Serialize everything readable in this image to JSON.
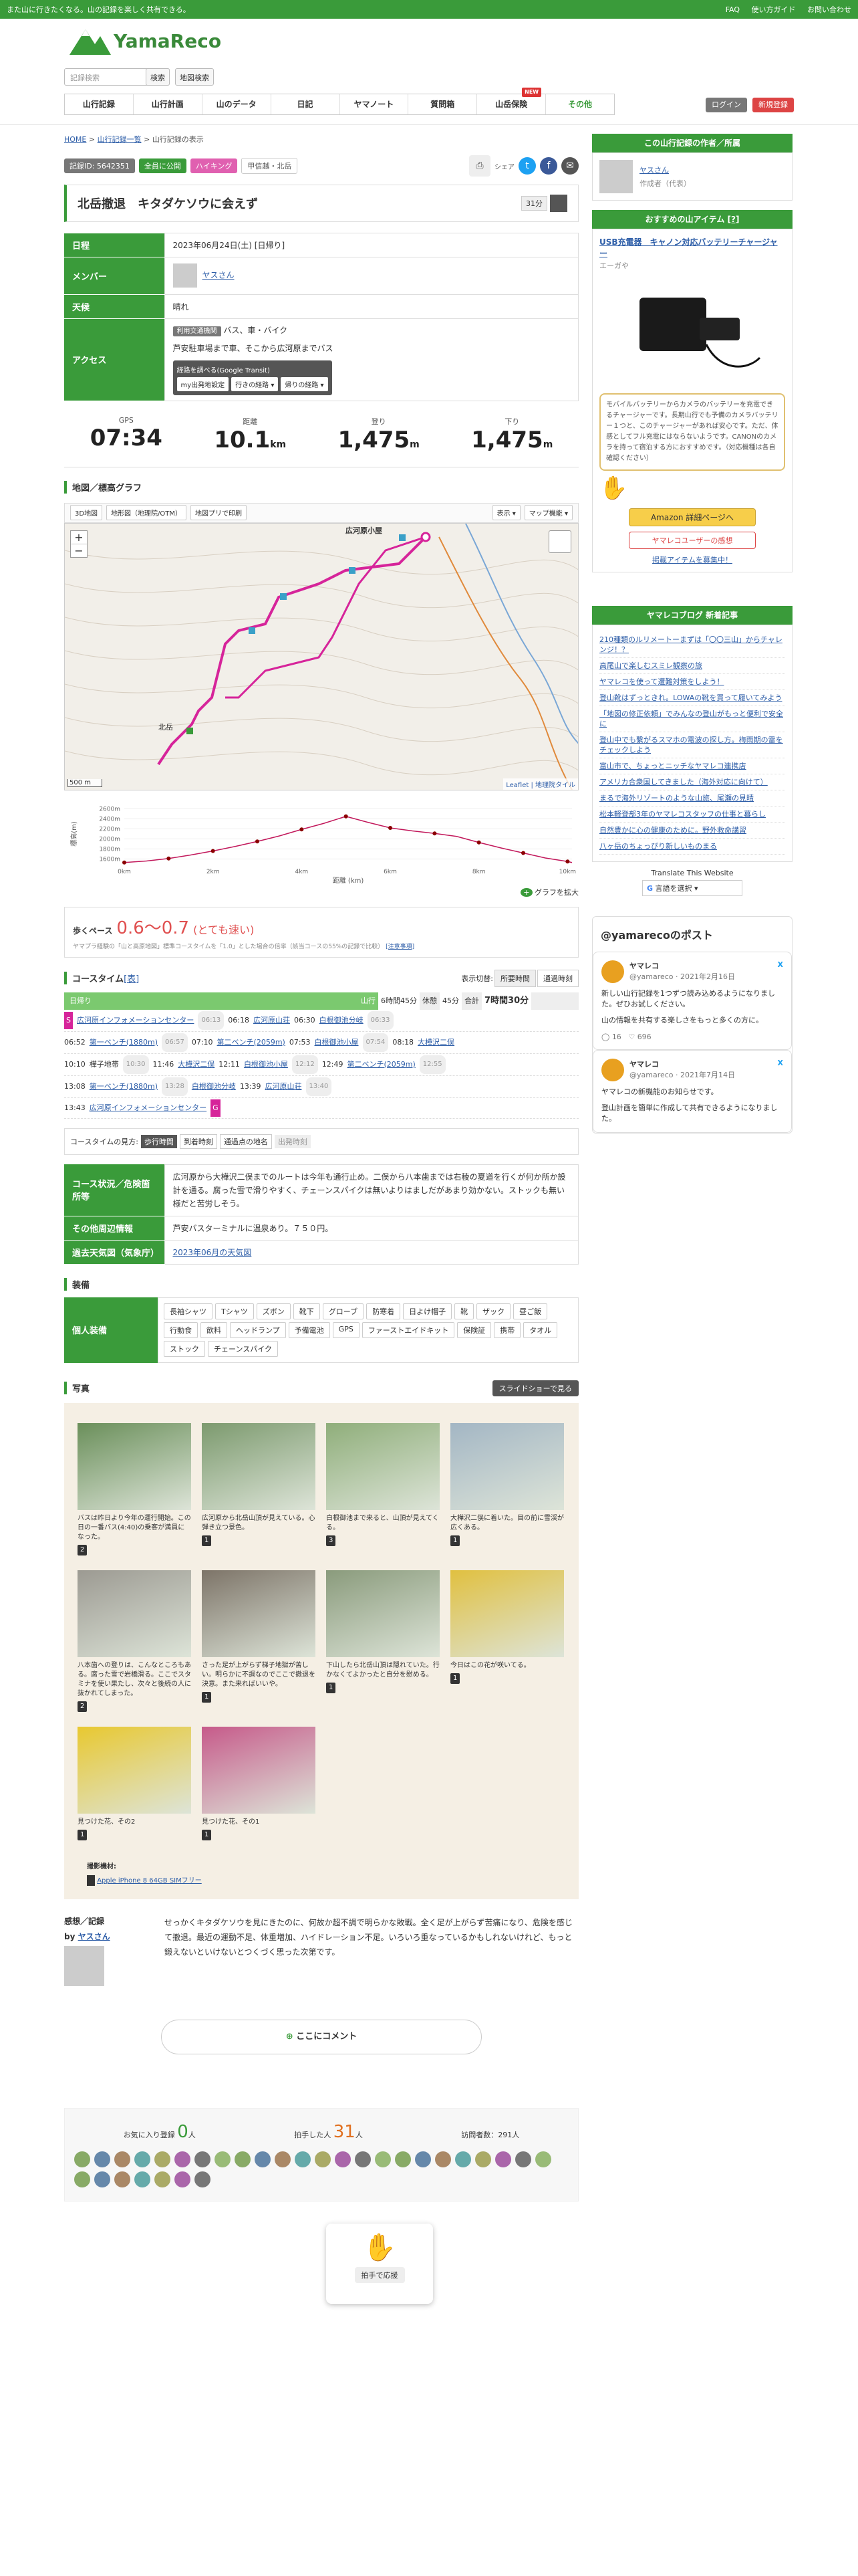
{
  "topbar": {
    "tagline": "また山に行きたくなる。山の記録を楽しく共有できる。",
    "links": [
      "FAQ",
      "使い方ガイド",
      "お問い合わせ"
    ]
  },
  "header": {
    "logo_text": "YamaReco",
    "search_placeholder": "記録検索",
    "search_button": "検索",
    "map_search_button": "地図検索",
    "nav": [
      "山行記録",
      "山行計画",
      "山のデータ",
      "日記",
      "ヤマノート",
      "質問箱",
      "山岳保険",
      "その他"
    ],
    "new_badge": "NEW",
    "login": "ログイン",
    "register": "新規登録"
  },
  "breadcrumb": {
    "home": "HOME",
    "list": "山行記録一覧",
    "current": "山行記録の表示"
  },
  "record": {
    "id": "記録ID: 5642351",
    "visibility": "全員に公開",
    "category": "ハイキング",
    "area": "甲信越・北岳",
    "share_label": "シェア",
    "title": "北岳撤退　キタダケソウに会えず",
    "count": "31",
    "count_unit": "分",
    "date_label": "日程",
    "date_value": "2023年06月24日(土) [日帰り]",
    "member_label": "メンバー",
    "member_name": "ヤスさん",
    "weather_label": "天候",
    "weather_value": "晴れ",
    "access_label": "アクセス",
    "access_tag": "利用交通機関",
    "access_mode": "バス、車・バイク",
    "access_note": "芦安駐車場まで車、そこから広河原までバス",
    "transit_label": "経路を調べる(Google Transit)",
    "transit_buttons": [
      "my出発地設定",
      "行きの経路 ▾",
      "帰りの経路 ▾"
    ]
  },
  "stats": [
    {
      "label": "GPS",
      "value": "07:34",
      "unit": ""
    },
    {
      "label": "距離",
      "value": "10.1",
      "unit": "km"
    },
    {
      "label": "登り",
      "value": "1,475",
      "unit": "m"
    },
    {
      "label": "下り",
      "value": "1,475",
      "unit": "m"
    }
  ],
  "map_section": {
    "title": "地図／標高グラフ",
    "buttons": [
      "3D地図",
      "地形図（地理院/OTM）",
      "地図プリで印刷"
    ],
    "right_buttons": [
      "表示 ▾",
      "マップ機能 ▾"
    ],
    "place_label": "広河原小屋",
    "place_label2": "北岳",
    "scale": "500 m",
    "attribution": "Leaflet | 地理院タイル",
    "zoom_in": "+",
    "zoom_out": "−"
  },
  "elevation": {
    "ylabel": "標高(m)",
    "xlabel": "距離 (km)",
    "enlarge": "グラフを拡大"
  },
  "chart_data": {
    "type": "line",
    "xlabel": "距離 (km)",
    "ylabel": "標高(m)",
    "x": [
      0,
      0.5,
      1,
      1.5,
      2,
      2.5,
      3,
      3.5,
      4,
      4.5,
      5,
      5.5,
      6,
      6.5,
      7,
      7.5,
      8,
      8.5,
      9,
      9.5,
      10,
      10.1
    ],
    "y": [
      1530,
      1560,
      1610,
      1680,
      1760,
      1850,
      1950,
      2060,
      2190,
      2310,
      2450,
      2330,
      2220,
      2160,
      2110,
      2050,
      1930,
      1820,
      1720,
      1620,
      1550,
      1530
    ],
    "xticks": [
      "0km",
      "2km",
      "4km",
      "6km",
      "8km",
      "10km"
    ],
    "yticks": [
      "1600m",
      "1800m",
      "2000m",
      "2200m",
      "2400m",
      "2600m"
    ],
    "ylim": [
      1500,
      2700
    ],
    "xlim": [
      0,
      10.1
    ]
  },
  "pace": {
    "label": "歩くペース",
    "value": "0.6〜0.7",
    "note": "(とても速い)",
    "sub": "ヤマプラ経験の「山と高原地図」標準コースタイムを「1.0」とした場合の倍率（該当コースの55%の記録で比較）",
    "link": "[注意事項]"
  },
  "coursetime": {
    "title": "コースタイム",
    "title_link": "[表]",
    "toggle_label": "表示切替:",
    "toggle_opts": [
      "所要時間",
      "通過時刻"
    ],
    "day_label": "日帰り",
    "mountain": "山行",
    "mountain_time": "6時間45分",
    "rest": "休憩",
    "rest_time": "45分",
    "total": "合計",
    "total_time": "7時間30分",
    "rows": [
      [
        "広河原インフォメーションセンター",
        "06:13",
        "06:18",
        "広河原山荘",
        "06:30",
        "白根御池分岐",
        "06:33"
      ],
      [
        "06:52",
        "第一ベンチ(1880m)",
        "06:57",
        "07:10",
        "第二ベンチ(2059m)",
        "07:53",
        "白根御池小屋",
        "07:54",
        "08:18",
        "大樺沢二俣"
      ],
      [
        "10:10",
        "樺子地帯",
        "10:30",
        "11:46",
        "大樺沢二俣",
        "12:11",
        "白根御池小屋",
        "12:12",
        "12:49",
        "第二ベンチ(2059m)",
        "12:55"
      ],
      [
        "13:08",
        "第一ベンチ(1880m)",
        "13:28",
        "白根御池分岐",
        "13:39",
        "広河原山荘",
        "13:40"
      ],
      [
        "13:43",
        "広河原インフォメーションセンター",
        "G"
      ]
    ],
    "view_label": "コースタイムの見方:",
    "view_opts": [
      "歩行時間",
      "到着時刻",
      "通過点の地名",
      "出発時刻"
    ]
  },
  "conditions": {
    "label": "コース状況／危険箇所等",
    "text": "広河原から大樺沢二俣までのルートは今年も通行止め。二俣から八本歯までは右稜の夏道を行くが何か所か設計を通る。腐った雪で滑りやすく、チェーンスパイクは無いよりはましだがあまり効かない。ストックも無い様だと苦労しそう。",
    "other_label": "その他周辺情報",
    "other_text": "芦安バスターミナルに温泉あり。７５０円。",
    "weather_label": "過去天気図（気象庁）",
    "weather_link": "2023年06月の天気図"
  },
  "gear": {
    "title": "装備",
    "label": "個人装備",
    "items": [
      "長袖シャツ",
      "Tシャツ",
      "ズボン",
      "靴下",
      "グローブ",
      "防寒着",
      "日よけ帽子",
      "靴",
      "ザック",
      "昼ご飯",
      "行動食",
      "飲料",
      "ヘッドランプ",
      "予備電池",
      "GPS",
      "ファーストエイドキット",
      "保険証",
      "携帯",
      "タオル",
      "ストック",
      "チェーンスパイク"
    ]
  },
  "photos": {
    "title": "写真",
    "slideshow": "スライドショーで見る",
    "items": [
      {
        "caption": "バスは昨日より今年の運行開始。この日の一番バス(4:40)の乗客が満員になった。",
        "likes": "2"
      },
      {
        "caption": "広河原から北岳山頂が見えている。心弾き立つ景色。",
        "likes": "1"
      },
      {
        "caption": "白根御池まで来ると、山頂が見えてくる。",
        "likes": "3"
      },
      {
        "caption": "大樺沢二俣に着いた。目の前に雪渓が広くある。",
        "likes": "1"
      },
      {
        "caption": "八本歯への登りは、こんなところもある。腐った雪で岩橋滑る。ここでスタミナを使い果たし、次々と後続の人に抜かれてしまった。",
        "likes": "2"
      },
      {
        "caption": "さった足が上がらず梯子地獄が苦しい。明らかに不調なのでここで撤退を決意。また来ればいいや。",
        "likes": "1"
      },
      {
        "caption": "下山したら北岳山頂は隠れていた。行かなくてよかったと自分を慰める。",
        "likes": "1"
      },
      {
        "caption": "今日はこの花が咲いてる。",
        "likes": "1"
      },
      {
        "caption": "見つけた花、その2",
        "likes": "1"
      },
      {
        "caption": "見つけた花、その1",
        "likes": "1"
      }
    ],
    "device_label": "撮影機材:",
    "device": "Apple iPhone 8 64GB SIMフリー"
  },
  "impression": {
    "label": "感想／記録",
    "by": "by",
    "author": "ヤスさん",
    "text": "せっかくキタダケソウを見にきたのに、何故か超不調で明らかな敗戦。全く足が上がらず苦痛になり、危険を感じて撤退。最近の運動不足、体重増加、ハイドレーション不足。いろいろ重なっているかもしれないけれど、もっと鍛えないといけないとつくづく思った次第です。"
  },
  "comment": {
    "add": "ここにコメント"
  },
  "clap": {
    "label": "拍手で応援",
    "fav_label": "お気に入り登録",
    "fav_count": "0",
    "fav_unit": "人",
    "clap_label": "拍手した人",
    "clap_count": "31",
    "clap_unit": "人",
    "visits": "訪問者数：291人"
  },
  "sidebar": {
    "author_head": "この山行記録の作者／所属",
    "author_name": "ヤスさん",
    "author_role": "作成者（代表）",
    "item_head": "おすすめの山アイテム",
    "item_help": "[?]",
    "item_title": "USB充電器　キャノン対応バッテリーチャージャー",
    "item_brand": "エーガや",
    "item_bubble": "モバイルバッテリーからカメラのバッテリーを充電できるチャージャーです。長期山行でも予備のカメラバッテリー１つと、このチャージャーがあれば安心です。ただ、体感としてフル充電にはならないようです。CANONのカメラを持って宿泊する方におすすめです。（対応機種は各自確認ください）",
    "amazon": "Amazon 詳細ページへ",
    "review": "ヤマレコユーザーの感想",
    "recruit": "掲載アイテムを募集中！",
    "blog_head": "ヤマレコブログ 新着記事",
    "blog": [
      "210種類のルリメートーまずは「〇〇三山」からチャレンジ！？",
      "高尾山で楽しむスミレ観察の旅",
      "ヤマレコを使って遭難対策をしよう！",
      "登山靴はずっときれ。LOWAの靴を買って履いてみよう",
      "「地図の修正依頼」でみんなの登山がもっと便利で安全に",
      "登山中でも繋がるスマホの電波の探し方。梅雨期の雷をチェックしよう",
      "富山市で、ちょっとニッチなヤマレコ連携店",
      "アメリカ合衆国してきました（海外対応に向けて）",
      "まるで海外リゾートのような山旅、尾瀬の見晴",
      "松本軽登部3年のヤマレコスタッフの仕事と暮らし",
      "自然豊かに心の健康のために。野外救命講習",
      "八ヶ岳のちょっぴり新しいものまる"
    ],
    "translate": "Translate This Website",
    "translate_btn": "言語を選択 ▾",
    "x_head": "@yamarecoのポスト",
    "posts": [
      {
        "name": "ヤマレコ",
        "handle": "@yamareco · 2021年2月16日",
        "text": "新しい山行記録を1つずつ読み込めるようになりました。ぜひお試しください。",
        "text2": "山の情報を共有する楽しさをもっと多くの方に。",
        "count1": "16",
        "count2": "696"
      },
      {
        "name": "ヤマレコ",
        "handle": "@yamareco · 2021年7月14日",
        "text": "ヤマレコの新機能のお知らせです。",
        "text2": "登山計画を簡単に作成して共有できるようになりました。"
      }
    ]
  }
}
